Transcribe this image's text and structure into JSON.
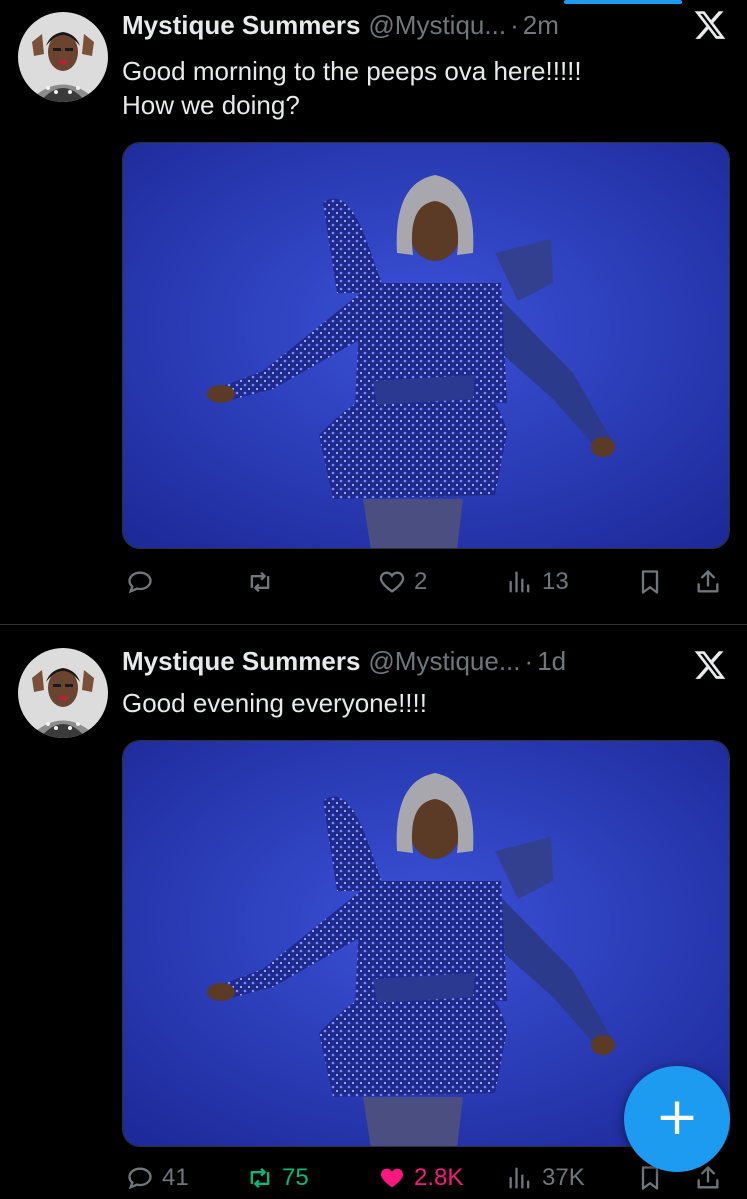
{
  "colors": {
    "background": "#000000",
    "text": "#e7e9ea",
    "secondary_text": "#71767b",
    "accent": "#1d9bf0",
    "retweet": "#00ba7c",
    "like": "#f91880",
    "photo_backdrop": "#2b3ec4"
  },
  "timeline": {
    "tweets": [
      {
        "display_name": "Mystique Summers",
        "handle": "@Mystiqu...",
        "separator": "·",
        "time": "2m",
        "text": "Good morning to the peeps ova here!!!!!\nHow we doing?",
        "media": "photo-person-blue-sequin-outfit",
        "replies": "",
        "retweets": "",
        "likes": "2",
        "views": "13",
        "retweeted": false,
        "liked": false
      },
      {
        "display_name": "Mystique Summers",
        "handle": "@Mystique...",
        "separator": "·",
        "time": "1d",
        "text": "Good evening everyone!!!!",
        "media": "photo-person-blue-sequin-outfit",
        "replies": "41",
        "retweets": "75",
        "likes": "2.8K",
        "views": "37K",
        "retweeted": true,
        "liked": true
      }
    ]
  },
  "icons": {
    "brand": "x-logo-icon",
    "reply": "reply-icon",
    "retweet": "retweet-icon",
    "like": "heart-icon",
    "views": "views-icon",
    "bookmark": "bookmark-icon",
    "share": "share-icon"
  },
  "fab": {
    "symbol": "+",
    "icon": "compose-plus-icon"
  }
}
